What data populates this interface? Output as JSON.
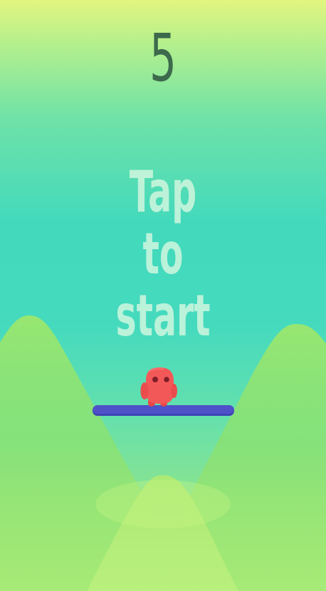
{
  "score": "5",
  "start_prompt": {
    "line1": "Tap",
    "line2": "to",
    "line3": "start"
  },
  "colors": {
    "sky_top": "#e2f57f",
    "sky_mid": "#42d9bd",
    "hill_green": "#92e26f",
    "player_red": "#f25656",
    "platform_blue": "#4f51c9",
    "score_text": "#3d6a4c"
  },
  "icons": {
    "player": "red-blob-character-icon",
    "hills": "green-hill-silhouettes"
  }
}
